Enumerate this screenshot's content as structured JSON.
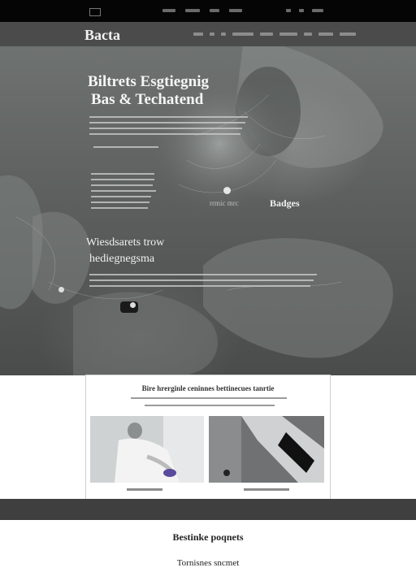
{
  "header": {
    "brand": "Bacta"
  },
  "hero": {
    "title_line1": "Biltrets Esgtiegnig",
    "title_line2": "Bas & Techatend",
    "cta_label": "rrmic mrc",
    "cta_strong": "Badges",
    "section_title_line1": "Wiesdsarets trow",
    "section_title_line2": "hediegnegsma"
  },
  "card": {
    "title": "Bire hrerginle ceninnes bettinecues tanrtie"
  },
  "bottom": {
    "heading": "Bestinke poqnets",
    "subheading": "Tornisnes sncmet"
  },
  "colors": {
    "topbar": "#050505",
    "header": "#4b4b4b",
    "band": "#3f3f3f"
  },
  "icons": [
    "menu-icon",
    "search-icon",
    "user-icon",
    "cart-icon"
  ]
}
